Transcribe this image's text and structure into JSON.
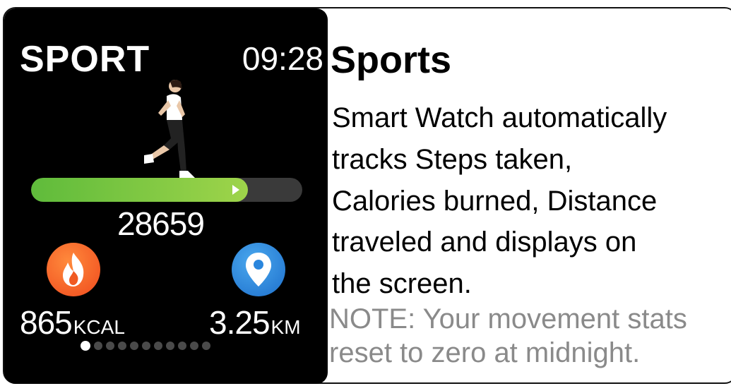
{
  "watch": {
    "title": "SPORT",
    "time": "09:28",
    "progress_fraction": 0.8,
    "steps": "28659",
    "calories_value": "865",
    "calories_unit": "KCAL",
    "distance_value": "3.25",
    "distance_unit": "KM",
    "page_count": 11,
    "active_page": 0,
    "icons": {
      "figure": "runner-icon",
      "calories": "flame-icon",
      "distance": "location-pin-icon"
    },
    "colors": {
      "progress": "#7cc943",
      "calories_badge": "#f05a22",
      "distance_badge": "#2a86dd"
    }
  },
  "copy": {
    "heading": "Sports",
    "description_lines": [
      "Smart Watch automatically",
      "tracks Steps taken,",
      "Calories burned, Distance",
      "traveled and displays on",
      "the screen."
    ],
    "note_lines": [
      "NOTE: Your movement stats",
      "reset  to zero at midnight."
    ]
  }
}
